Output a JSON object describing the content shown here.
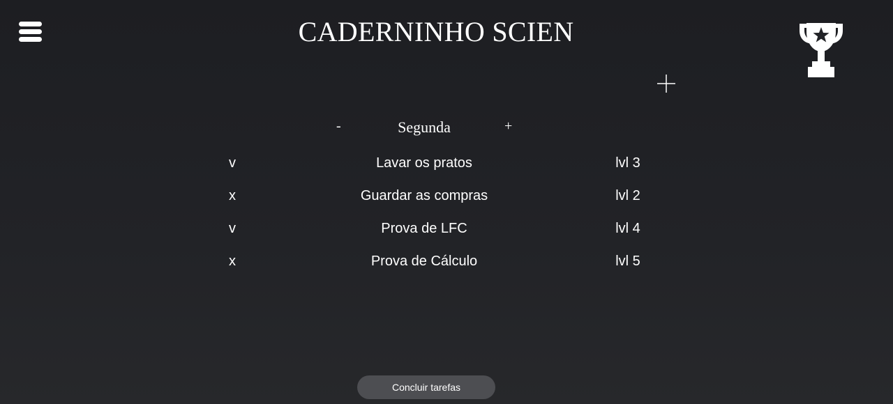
{
  "header": {
    "title": "CADERNINHO SCIEN",
    "menu_icon": "hamburger-icon",
    "trophy_icon": "trophy-icon",
    "add_icon": "plus-icon"
  },
  "day_nav": {
    "prev_label": "-",
    "day": "Segunda",
    "next_label": "+"
  },
  "tasks": [
    {
      "status": "v",
      "name": "Lavar os pratos",
      "level": "lvl 3"
    },
    {
      "status": "x",
      "name": "Guardar as compras",
      "level": "lvl 2"
    },
    {
      "status": "v",
      "name": "Prova de LFC",
      "level": "lvl 4"
    },
    {
      "status": "x",
      "name": "Prova de Cálculo",
      "level": "lvl 5"
    }
  ],
  "footer": {
    "conclude_label": "Concluir tarefas"
  },
  "colors": {
    "background": "#1f2024",
    "text": "#ffffff",
    "button_bg": "#4d4e52"
  }
}
